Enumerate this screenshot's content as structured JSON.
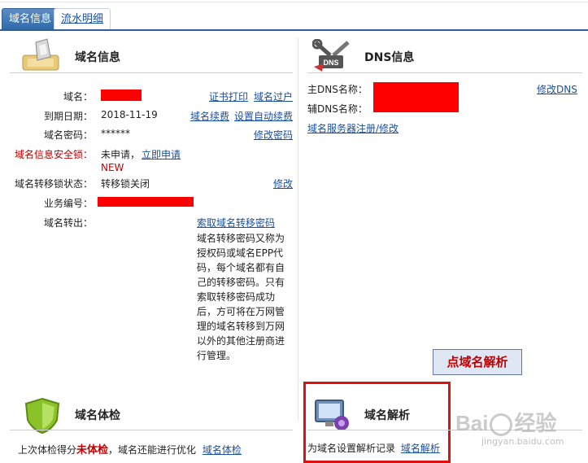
{
  "tabs": [
    {
      "label": "域名信息",
      "active": true
    },
    {
      "label": "流水明细",
      "active": false
    }
  ],
  "domain_info": {
    "title": "域名信息",
    "actions": {
      "cert_print": "证书打印",
      "transfer_owner": "域名过户",
      "renew": "域名续费",
      "auto_renew": "设置自动续费",
      "change_password": "修改密码",
      "modify": "修改",
      "get_transfer_code": "索取域名转移密码"
    },
    "rows": {
      "domain_label": "域名：",
      "expiry_label": "到期日期：",
      "expiry_value": "2018-11-19",
      "password_label": "域名密码：",
      "password_value": "******",
      "lock_label": "域名信息安全锁：",
      "lock_value": "未申请，",
      "lock_apply": "立即申请",
      "lock_new": "NEW",
      "transfer_lock_label": "域名转移锁状态：",
      "transfer_lock_value": "转移锁关闭",
      "biz_label": "业务编号：",
      "transfer_out_label": "域名转出："
    },
    "transfer_note": "域名转移密码又称为授权码或域名EPP代码，每个域名都有自己的转移密码。只有索取转移密码成功后，方可将在万网管理的域名转移到万网以外的其他注册商进行管理。"
  },
  "dns_info": {
    "title": "DNS信息",
    "primary_label": "主DNS名称：",
    "secondary_label": "辅DNS名称：",
    "modify_dns": "修改DNS",
    "register_link": "域名服务器注册/修改"
  },
  "callout": {
    "text": "点域名解析"
  },
  "health": {
    "title": "域名体检",
    "text_prefix": "上次体检得分",
    "text_bold": "未体检",
    "text_suffix": "，域名还能进行优化",
    "link": "域名体检"
  },
  "resolve": {
    "title": "域名解析",
    "text": "为域名设置解析记录",
    "link": "域名解析"
  },
  "watermark": {
    "brand": "Bai",
    "brand2": "经验",
    "url": "jingyan.baidu.com"
  },
  "colors": {
    "accent": "#2d5f9a",
    "link": "#1a4f9c",
    "redact": "#ff0000",
    "highlight_box": "#e01010",
    "warning_text": "#c00000"
  }
}
